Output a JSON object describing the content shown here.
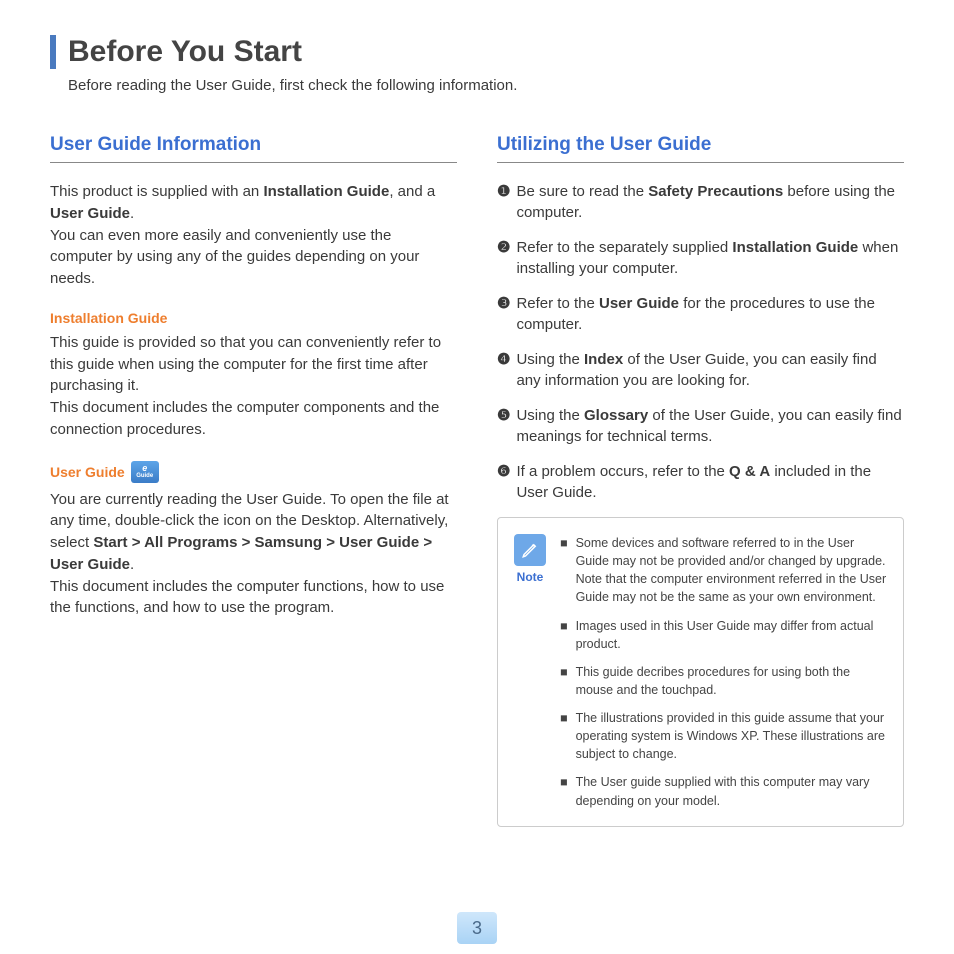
{
  "title": "Before You Start",
  "subtitle": "Before reading the User Guide, first check the following information.",
  "left": {
    "heading": "User Guide Information",
    "intro_html": "This product is supplied with an <b>Installation Guide</b>, and a <b>User Guide</b>.<br>You can even more easily and conveniently use the computer by using any of the guides depending on your needs.",
    "install_heading": "Installation Guide",
    "install_text": "This guide is provided so that you can conveniently refer to this guide when using the computer for the first time after purchasing it.<br>This document includes the computer components and the connection procedures.",
    "userguide_heading": "User Guide",
    "userguide_text_html": "You are currently reading the User Guide. To open the file at any time, double-click the icon on the Desktop. Alternatively, select <b>Start > All Programs > Samsung > User Guide > User Guide</b>.<br>This document includes the computer functions, how to use the functions, and how to use the program."
  },
  "right": {
    "heading": "Utilizing the User Guide",
    "items": [
      {
        "n": "❶",
        "html": "Be sure to read the <b>Safety Precautions</b> before using the computer."
      },
      {
        "n": "❷",
        "html": "Refer to the separately supplied <b>Installation Guide</b> when installing your computer."
      },
      {
        "n": "❸",
        "html": "Refer to the <b>User Guide</b> for the procedures to use the computer."
      },
      {
        "n": "❹",
        "html": "Using the <b>Index</b> of the User Guide, you can easily find any information you are looking for."
      },
      {
        "n": "❺",
        "html": "Using the <b>Glossary</b> of the User Guide, you can easily find meanings for technical terms."
      },
      {
        "n": "❻",
        "html": "If a problem occurs, refer to the <b>Q & A</b> included in the User Guide."
      }
    ],
    "note_label": "Note",
    "notes": [
      "Some devices and software referred to in the User Guide may not be provided and/or changed by upgrade.<br>Note that the computer environment referred in the User Guide may not be the same as your own environment.",
      "Images used in this User Guide may differ from actual product.",
      "This guide decribes procedures for using both the mouse and the touchpad.",
      "The illustrations provided in this guide assume that your operating system is Windows XP. These illustrations are subject to change.",
      "The User guide supplied with this computer may vary depending on your model."
    ]
  },
  "page_number": "3",
  "eguide_icon_text": "eGuide"
}
